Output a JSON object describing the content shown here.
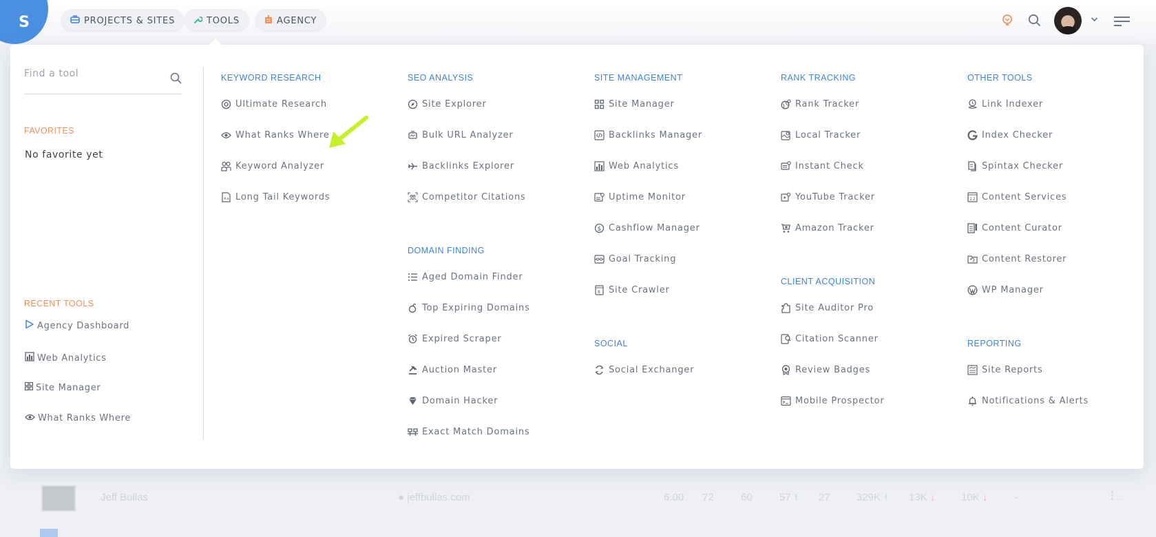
{
  "header": {
    "logo_letter": "S",
    "nav": [
      {
        "label": "PROJECTS & SITES",
        "icon": "briefcase-icon",
        "color": "#3c85d8"
      },
      {
        "label": "TOOLS",
        "icon": "wrench-icon",
        "color": "#2bb88a"
      },
      {
        "label": "AGENCY",
        "icon": "building-icon",
        "color": "#f0915a"
      }
    ],
    "right_icons": [
      "lightbulb-icon",
      "search-icon",
      "avatar",
      "chevron-down-icon",
      "menu-icon"
    ]
  },
  "colors": {
    "accent_blue": "#3c85d8",
    "accent_orange": "#f0915a",
    "logo_blue": "#4a8fe0",
    "arrow_green": "#c6f02a",
    "up_green": "#4caf50",
    "down_red": "#e53950"
  },
  "tools_menu": {
    "search_placeholder": "Find a tool",
    "favorites": {
      "title": "FAVORITES",
      "empty_text": "No favorite yet"
    },
    "recent": {
      "title": "RECENT TOOLS",
      "items": [
        {
          "label": "Agency Dashboard",
          "icon": "play-triangle-icon"
        },
        {
          "label": "Web Analytics",
          "icon": "bar-chart-icon"
        },
        {
          "label": "Site Manager",
          "icon": "grid-icon"
        },
        {
          "label": "What Ranks Where",
          "icon": "eye-icon"
        }
      ]
    },
    "columns": [
      {
        "sections": [
          {
            "title": "KEYWORD RESEARCH",
            "items": [
              {
                "label": "Ultimate Research",
                "icon": "at-circle-icon",
                "highlighted": true
              },
              {
                "label": "What Ranks Where",
                "icon": "eye-icon"
              },
              {
                "label": "Keyword Analyzer",
                "icon": "users-icon"
              },
              {
                "label": "Long Tail Keywords",
                "icon": "document-icon"
              }
            ]
          }
        ]
      },
      {
        "sections": [
          {
            "title": "SEO ANALYSIS",
            "items": [
              {
                "label": "Site Explorer",
                "icon": "compass-icon"
              },
              {
                "label": "Bulk URL Analyzer",
                "icon": "robot-icon"
              },
              {
                "label": "Backlinks Explorer",
                "icon": "plane-icon"
              },
              {
                "label": "Competitor Citations",
                "icon": "scan-users-icon"
              }
            ]
          },
          {
            "title": "DOMAIN FINDING",
            "items": [
              {
                "label": "Aged Domain Finder",
                "icon": "list-icon"
              },
              {
                "label": "Top Expiring Domains",
                "icon": "bomb-icon"
              },
              {
                "label": "Expired Scraper",
                "icon": "alarm-clock-icon"
              },
              {
                "label": "Auction Master",
                "icon": "gavel-icon"
              },
              {
                "label": "Domain Hacker",
                "icon": "diamond-icon"
              },
              {
                "label": "Exact Match Domains",
                "icon": "match-icon"
              }
            ]
          }
        ]
      },
      {
        "sections": [
          {
            "title": "SITE MANAGEMENT",
            "items": [
              {
                "label": "Site Manager",
                "icon": "grid-icon"
              },
              {
                "label": "Backlinks Manager",
                "icon": "code-icon"
              },
              {
                "label": "Web Analytics",
                "icon": "bar-chart-icon"
              },
              {
                "label": "Uptime Monitor",
                "icon": "monitor-icon"
              },
              {
                "label": "Cashflow Manager",
                "icon": "dollar-circle-icon"
              },
              {
                "label": "Goal Tracking",
                "icon": "goal-icon"
              },
              {
                "label": "Site Crawler",
                "icon": "crawler-icon"
              }
            ]
          },
          {
            "title": "SOCIAL",
            "items": [
              {
                "label": "Social Exchanger",
                "icon": "refresh-icon"
              }
            ]
          }
        ]
      },
      {
        "sections": [
          {
            "title": "RANK TRACKING",
            "items": [
              {
                "label": "Rank Tracker",
                "icon": "globe-pin-icon"
              },
              {
                "label": "Local Tracker",
                "icon": "map-pin-icon"
              },
              {
                "label": "Instant Check",
                "icon": "check-card-icon"
              },
              {
                "label": "YouTube Tracker",
                "icon": "video-icon"
              },
              {
                "label": "Amazon Tracker",
                "icon": "cart-icon"
              }
            ]
          },
          {
            "title": "CLIENT ACQUISITION",
            "items": [
              {
                "label": "Site Auditor Pro",
                "icon": "puzzle-icon"
              },
              {
                "label": "Citation Scanner",
                "icon": "scanner-icon"
              },
              {
                "label": "Review Badges",
                "icon": "badge-icon"
              },
              {
                "label": "Mobile Prospector",
                "icon": "terminal-icon"
              }
            ]
          }
        ]
      },
      {
        "sections": [
          {
            "title": "OTHER TOOLS",
            "items": [
              {
                "label": "Link Indexer",
                "icon": "link-pin-icon"
              },
              {
                "label": "Index Checker",
                "icon": "google-icon"
              },
              {
                "label": "Spintax Checker",
                "icon": "copy-doc-icon"
              },
              {
                "label": "Content Services",
                "icon": "calendar-icon"
              },
              {
                "label": "Content Curator",
                "icon": "curator-icon"
              },
              {
                "label": "Content Restorer",
                "icon": "folder-restore-icon"
              },
              {
                "label": "WP Manager",
                "icon": "wordpress-icon"
              }
            ]
          },
          {
            "title": "REPORTING",
            "items": [
              {
                "label": "Site Reports",
                "icon": "report-icon"
              },
              {
                "label": "Notifications & Alerts",
                "icon": "bell-icon"
              }
            ]
          }
        ]
      }
    ]
  },
  "background_table_row": {
    "name": "Jeff Bullas",
    "domain": "jeffbullas.com",
    "values": [
      {
        "text": "6.00"
      },
      {
        "text": "72"
      },
      {
        "text": "60"
      },
      {
        "text": "57",
        "trend": "up"
      },
      {
        "text": "27"
      },
      {
        "text": "329K",
        "trend": "up"
      },
      {
        "text": "13K",
        "trend": "down"
      },
      {
        "text": "10K",
        "trend": "down"
      },
      {
        "text": "-"
      }
    ],
    "more_label": "..."
  }
}
